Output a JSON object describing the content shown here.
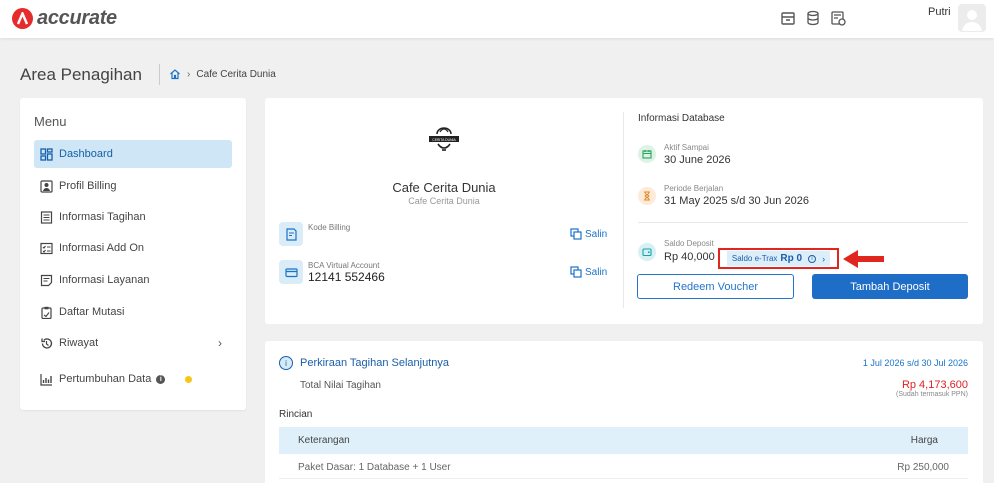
{
  "header": {
    "brand": "accurate",
    "user_name": "Putri"
  },
  "page": {
    "title": "Area Penagihan",
    "breadcrumb": "Cafe Cerita Dunia"
  },
  "menu": {
    "title": "Menu",
    "items": [
      {
        "label": "Dashboard",
        "icon": "dashboard-icon",
        "active": true
      },
      {
        "label": "Profil Billing",
        "icon": "profile-icon"
      },
      {
        "label": "Informasi Tagihan",
        "icon": "invoice-icon"
      },
      {
        "label": "Informasi Add On",
        "icon": "addon-icon"
      },
      {
        "label": "Informasi Layanan",
        "icon": "service-icon"
      },
      {
        "label": "Daftar Mutasi",
        "icon": "clipboard-icon"
      },
      {
        "label": "Riwayat",
        "icon": "history-icon"
      },
      {
        "label": "Pertumbuhan Data",
        "icon": "growth-chart-icon"
      }
    ]
  },
  "company": {
    "name": "Cafe Cerita Dunia",
    "subtitle": "Cafe Cerita Dunia",
    "logo_text": "CERITA DUNIA",
    "kode_billing_label": "Kode Billing",
    "kode_billing_value": "",
    "bca_label": "BCA Virtual Account",
    "bca_value": "12141 552466",
    "copy_label": "Salin"
  },
  "database": {
    "title": "Informasi Database",
    "aktif_label": "Aktif Sampai",
    "aktif_value": "30 June 2026",
    "periode_label": "Periode Berjalan",
    "periode_value": "31 May 2025 s/d 30 Jun 2026",
    "saldo_label": "Saldo Deposit",
    "saldo_value": "Rp 40,000",
    "etrax_label": "Saldo e-Trax",
    "etrax_value": "Rp 0",
    "redeem_label": "Redeem Voucher",
    "deposit_label": "Tambah Deposit"
  },
  "billing": {
    "title": "Perkiraan Tagihan Selanjutnya",
    "period": "1 Jul 2026 s/d 30 Jul 2026",
    "total_label": "Total Nilai Tagihan",
    "total_value": "Rp 4,173,600",
    "total_note": "(Sudah termasuk PPN)",
    "rincian_label": "Rincian",
    "col_desc": "Keterangan",
    "col_price": "Harga",
    "rows": [
      {
        "desc": "Paket Dasar: 1 Database + 1 User",
        "price": "Rp 250,000"
      }
    ]
  },
  "colors": {
    "accent": "#1e6ec8",
    "brand_red": "#e52b2b",
    "highlight_border": "#e0261e",
    "active_bg": "#cfe6f6"
  }
}
